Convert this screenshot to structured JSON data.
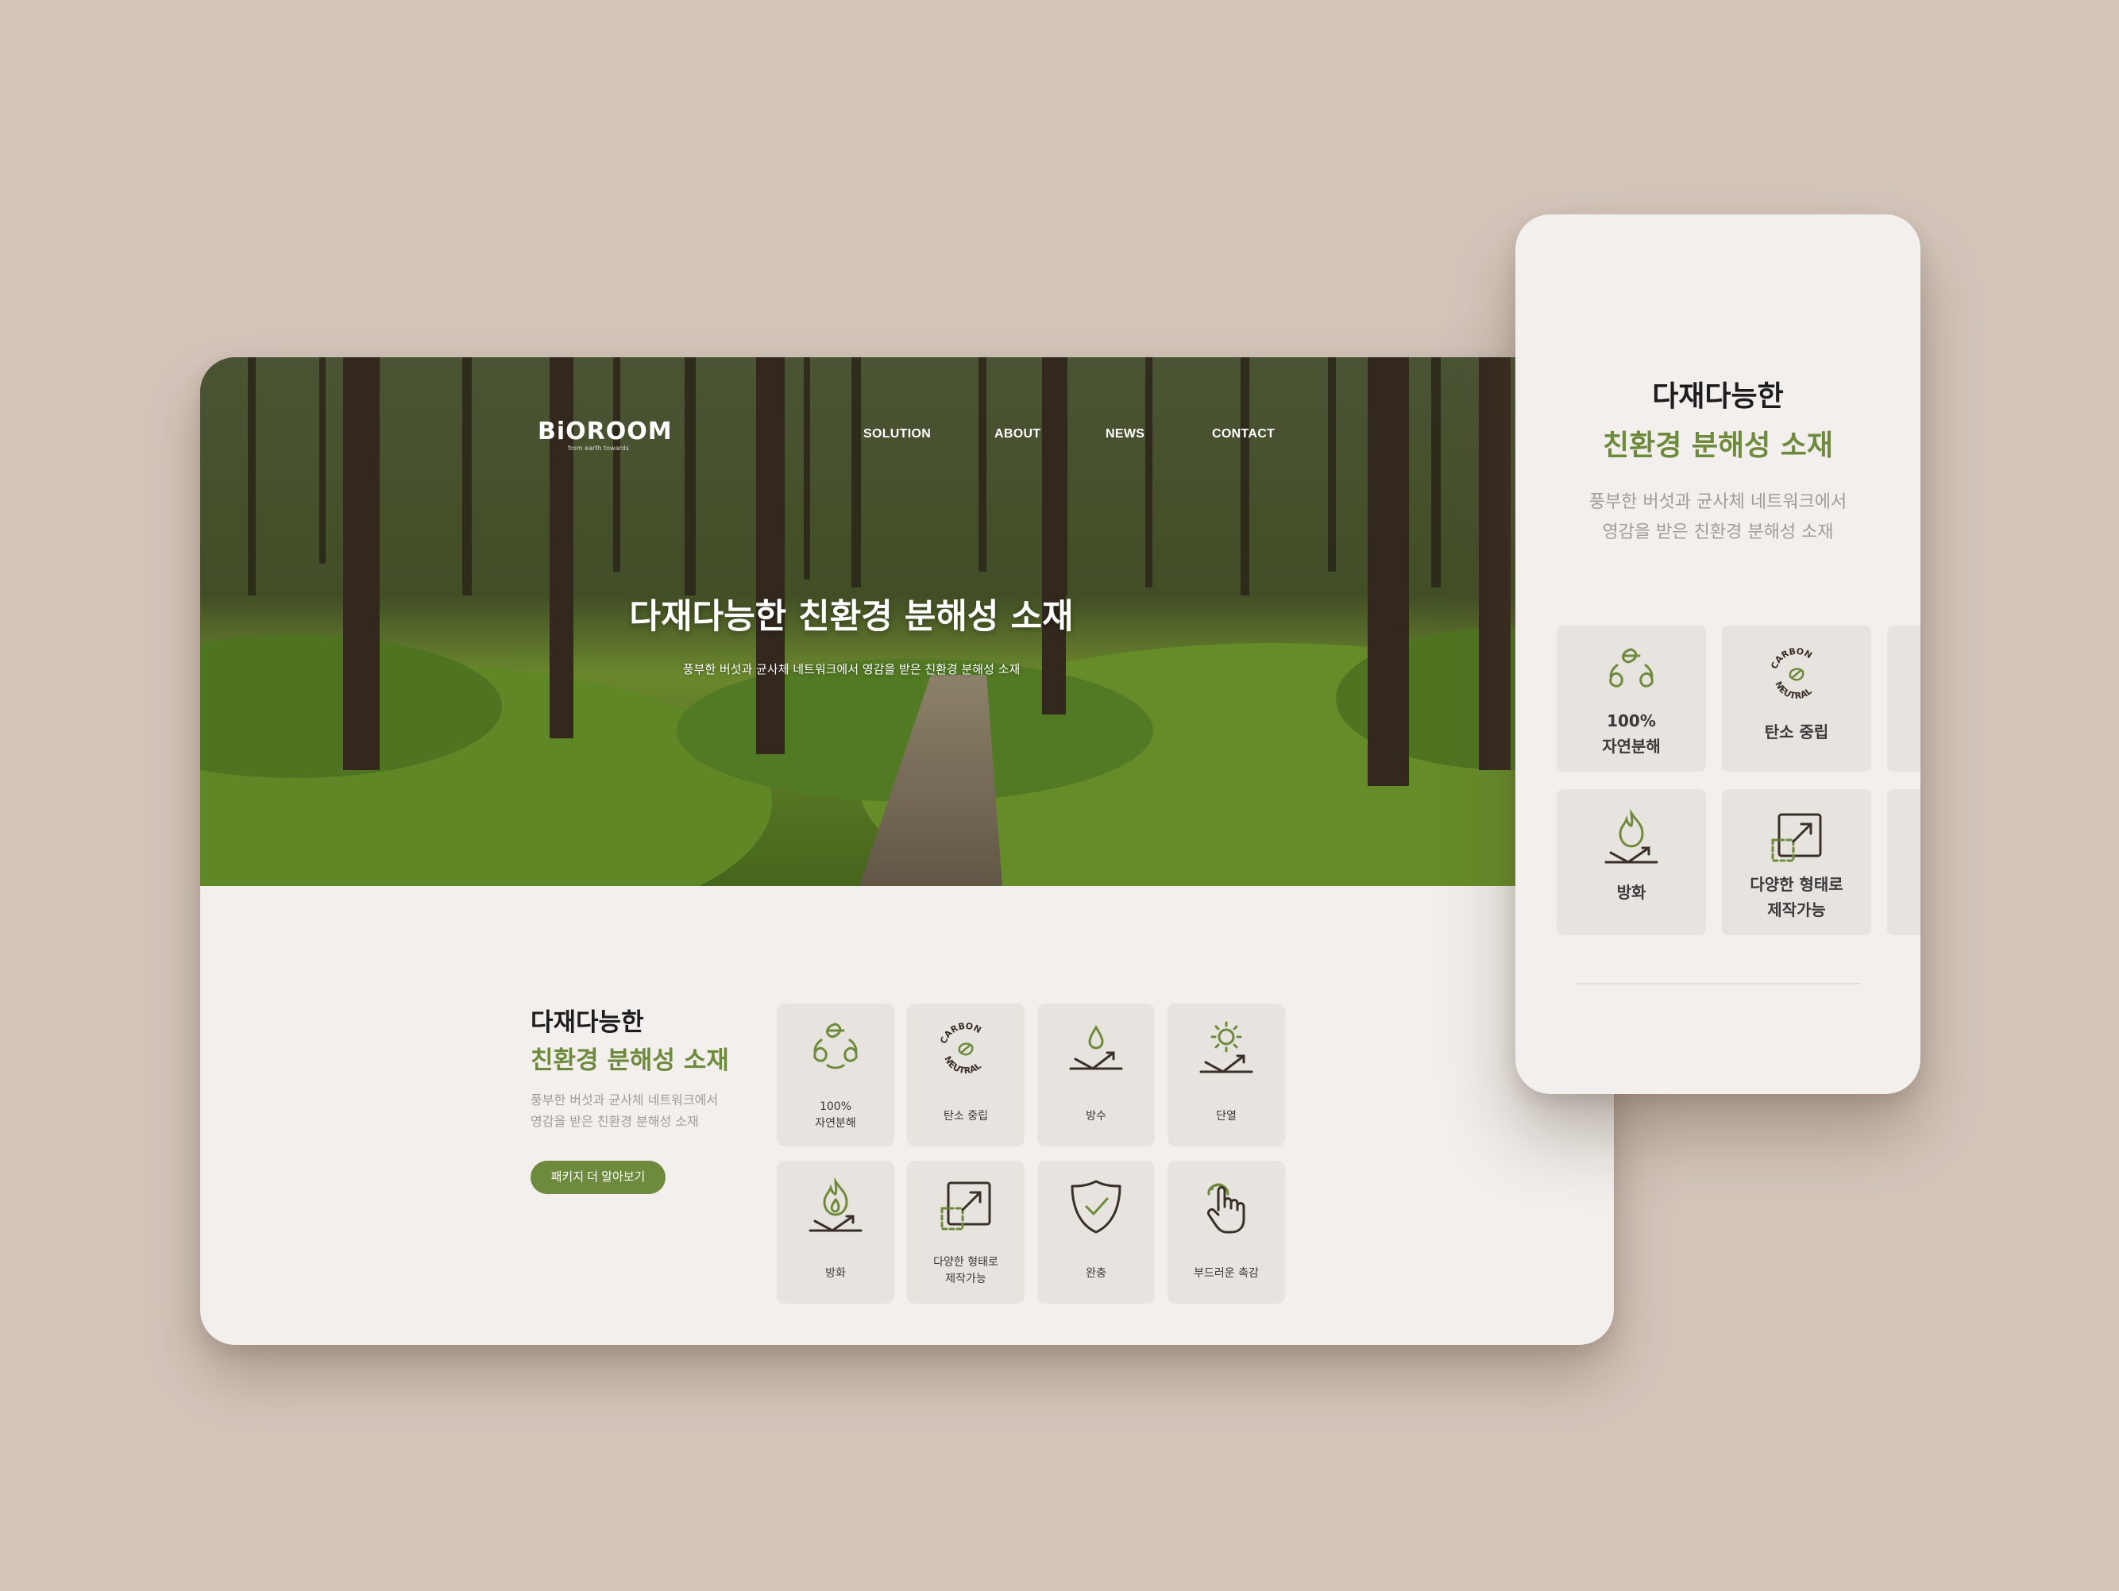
{
  "desktop": {
    "header": {
      "logo": "BiOROOM",
      "logo_tagline": "from earth towards",
      "nav": [
        "SOLUTION",
        "ABOUT",
        "NEWS",
        "CONTACT"
      ]
    },
    "hero": {
      "title": "다재다능한 친환경 분해성 소재",
      "subtitle": "풍부한 버섯과 균사체 네트워크에서 영감을 받은 친환경 분해성 소재"
    },
    "features": {
      "heading_line1": "다재다능한",
      "heading_line2": "친환경 분해성 소재",
      "desc_line1": "풍부한 버섯과 균사체 네트워크에서",
      "desc_line2": "영감을 받은 친환경 분해성 소재",
      "button": "패키지 더 알아보기",
      "items": [
        {
          "icon": "recycle-leaves-icon",
          "line1": "100%",
          "line2": "자연분해"
        },
        {
          "icon": "carbon-neutral-icon",
          "line1": "탄소 중립",
          "line2": ""
        },
        {
          "icon": "waterproof-icon",
          "line1": "방수",
          "line2": ""
        },
        {
          "icon": "insulation-icon",
          "line1": "단열",
          "line2": ""
        },
        {
          "icon": "fire-resistant-icon",
          "line1": "방화",
          "line2": ""
        },
        {
          "icon": "resize-form-icon",
          "line1": "다양한 형태로",
          "line2": "제작가능"
        },
        {
          "icon": "shield-check-icon",
          "line1": "완충",
          "line2": ""
        },
        {
          "icon": "touch-hand-icon",
          "line1": "부드러운 촉감",
          "line2": ""
        }
      ]
    }
  },
  "mobile": {
    "heading_line1": "다재다능한",
    "heading_line2": "친환경 분해성 소재",
    "desc_line1": "풍부한 버섯과 균사체 네트워크에서",
    "desc_line2": "영감을 받은 친환경 분해성 소재",
    "items": [
      {
        "icon": "recycle-leaves-icon",
        "line1": "100%",
        "line2": "자연분해"
      },
      {
        "icon": "carbon-neutral-icon",
        "line1": "탄소 중립",
        "line2": ""
      },
      {
        "icon": "fire-resistant-icon",
        "line1": "방화",
        "line2": ""
      },
      {
        "icon": "resize-form-icon",
        "line1": "다양한 형태로",
        "line2": "제작가능"
      }
    ],
    "carbon_text_top": "CARBON",
    "carbon_text_bottom": "NEUTRAL"
  },
  "colors": {
    "background": "#d5c6bc",
    "card": "#f2efec",
    "tile": "#e7e3df",
    "accent_green": "#6e8a3c",
    "heading": "#1d1d1d",
    "muted_text": "#a39c96"
  }
}
